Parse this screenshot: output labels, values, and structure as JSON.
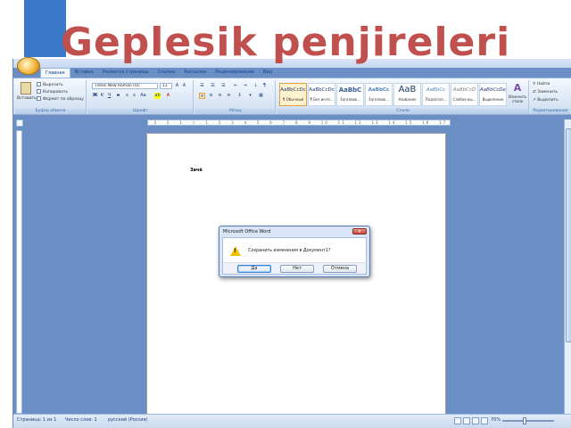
{
  "slide": {
    "title": "Geplesik  penjireleri"
  },
  "word": {
    "tabs": [
      "Главная",
      "Вставка",
      "Разметка страницы",
      "Ссылки",
      "Рассылки",
      "Рецензирование",
      "Вид"
    ],
    "ribbon": {
      "clipboard": {
        "paste_label": "Вставить",
        "cut_label": "Вырезать",
        "copy_label": "Копировать",
        "format_label": "Формат по образцу",
        "group_label": "Буфер обмена"
      },
      "font": {
        "font_name": "Times New Roman (Ос",
        "font_size": "11",
        "group_label": "Шрифт"
      },
      "paragraph": {
        "group_label": "Абзац"
      },
      "styles": {
        "items": [
          {
            "preview": "AaBbCcDc",
            "name": "¶ Обычный"
          },
          {
            "preview": "AaBbCcDc",
            "name": "¶ Без инте..."
          },
          {
            "preview": "AaBbC",
            "name": "Заголово..."
          },
          {
            "preview": "AaBbCc",
            "name": "Заголово..."
          },
          {
            "preview": "AaB",
            "name": "Название"
          },
          {
            "preview": "AaBbCc",
            "name": "Подзагол..."
          },
          {
            "preview": "AaBbCcD",
            "name": "Слабое вы..."
          },
          {
            "preview": "AaBbCcDe",
            "name": "Выделение"
          }
        ],
        "change_styles_label": "Изменить стили",
        "group_label": "Стили"
      },
      "editing": {
        "find_label": "Найти",
        "replace_label": "Заменить",
        "select_label": "Выделить",
        "group_label": "Редактирование"
      }
    },
    "document": {
      "text": "Зачё"
    },
    "dialog": {
      "title": "Microsoft Office Word",
      "close_glyph": "x",
      "message": "Сохранить изменения в Документ1?",
      "yes_label": "Да",
      "no_label": "Нет",
      "cancel_label": "Отмена"
    },
    "status": {
      "page": "Страница: 1 из 1",
      "words": "Число слов: 1",
      "language": "русский (Россия)",
      "zoom": "70%"
    }
  }
}
